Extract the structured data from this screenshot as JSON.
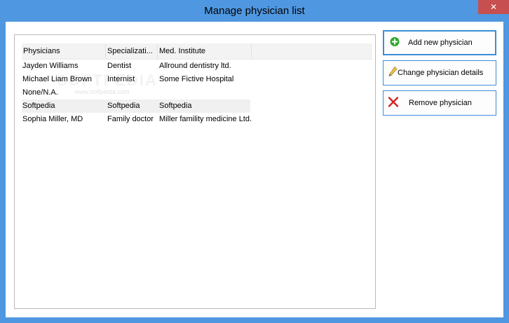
{
  "window": {
    "title": "Manage physician list",
    "close_glyph": "✕"
  },
  "list": {
    "columns": [
      "Physicians",
      "Specializati...",
      "Med. Institute"
    ],
    "rows": [
      {
        "physician": "Jayden Williams",
        "specialization": "Dentist",
        "institute": "Allround dentistry ltd."
      },
      {
        "physician": "Michael Liam Brown",
        "specialization": "Internist",
        "institute": "Some Fictive Hospital"
      },
      {
        "physician": "None/N.A.",
        "specialization": "",
        "institute": ""
      },
      {
        "physician": "Softpedia",
        "specialization": "Softpedia",
        "institute": "Softpedia"
      },
      {
        "physician": "Sophia Miller, MD",
        "specialization": "Family doctor",
        "institute": "Miller famility medicine Ltd."
      }
    ],
    "selected_row_index": 3
  },
  "watermark": {
    "text": "SOFTPEDIA",
    "sub": "www.softpedia.com"
  },
  "buttons": {
    "add": {
      "label": "Add new physician",
      "icon": "plus-circle-icon",
      "color": "#2fa82f"
    },
    "change": {
      "label": "Change physician details",
      "icon": "pencil-icon"
    },
    "remove": {
      "label": "Remove physician",
      "icon": "red-x-icon",
      "color": "#d62020"
    }
  },
  "colors": {
    "accent": "#3c8ed9",
    "titlebar": "#4f97e0",
    "close": "#c74f4f"
  }
}
